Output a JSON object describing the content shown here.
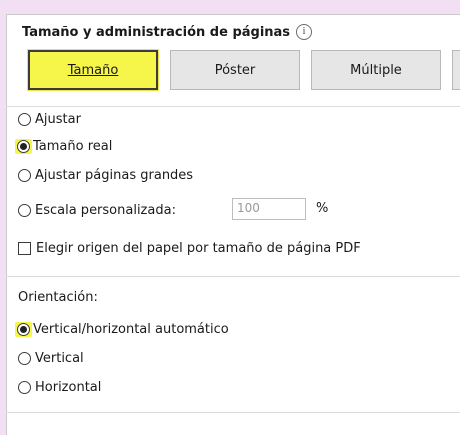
{
  "section": {
    "title": "Tamaño y administración de páginas",
    "info_icon": "i"
  },
  "tabs": [
    {
      "label": "Tamaño",
      "active": true
    },
    {
      "label": "Póster",
      "active": false
    },
    {
      "label": "Múltiple",
      "active": false
    }
  ],
  "sizing": {
    "options": [
      {
        "label": "Ajustar",
        "checked": false
      },
      {
        "label": "Tamaño real",
        "checked": true
      },
      {
        "label": "Ajustar páginas grandes",
        "checked": false
      },
      {
        "label": "Escala personalizada:",
        "checked": false
      }
    ],
    "scale_value": "100",
    "scale_unit": "%",
    "paper_source_checkbox": "Elegir origen del papel por tamaño de página PDF"
  },
  "orientation": {
    "label": "Orientación:",
    "options": [
      {
        "label": "Vertical/horizontal automático",
        "checked": true
      },
      {
        "label": "Vertical",
        "checked": false
      },
      {
        "label": "Horizontal",
        "checked": false
      }
    ]
  },
  "colors": {
    "highlight": "#f6f54a",
    "background": "#f3dff4"
  }
}
